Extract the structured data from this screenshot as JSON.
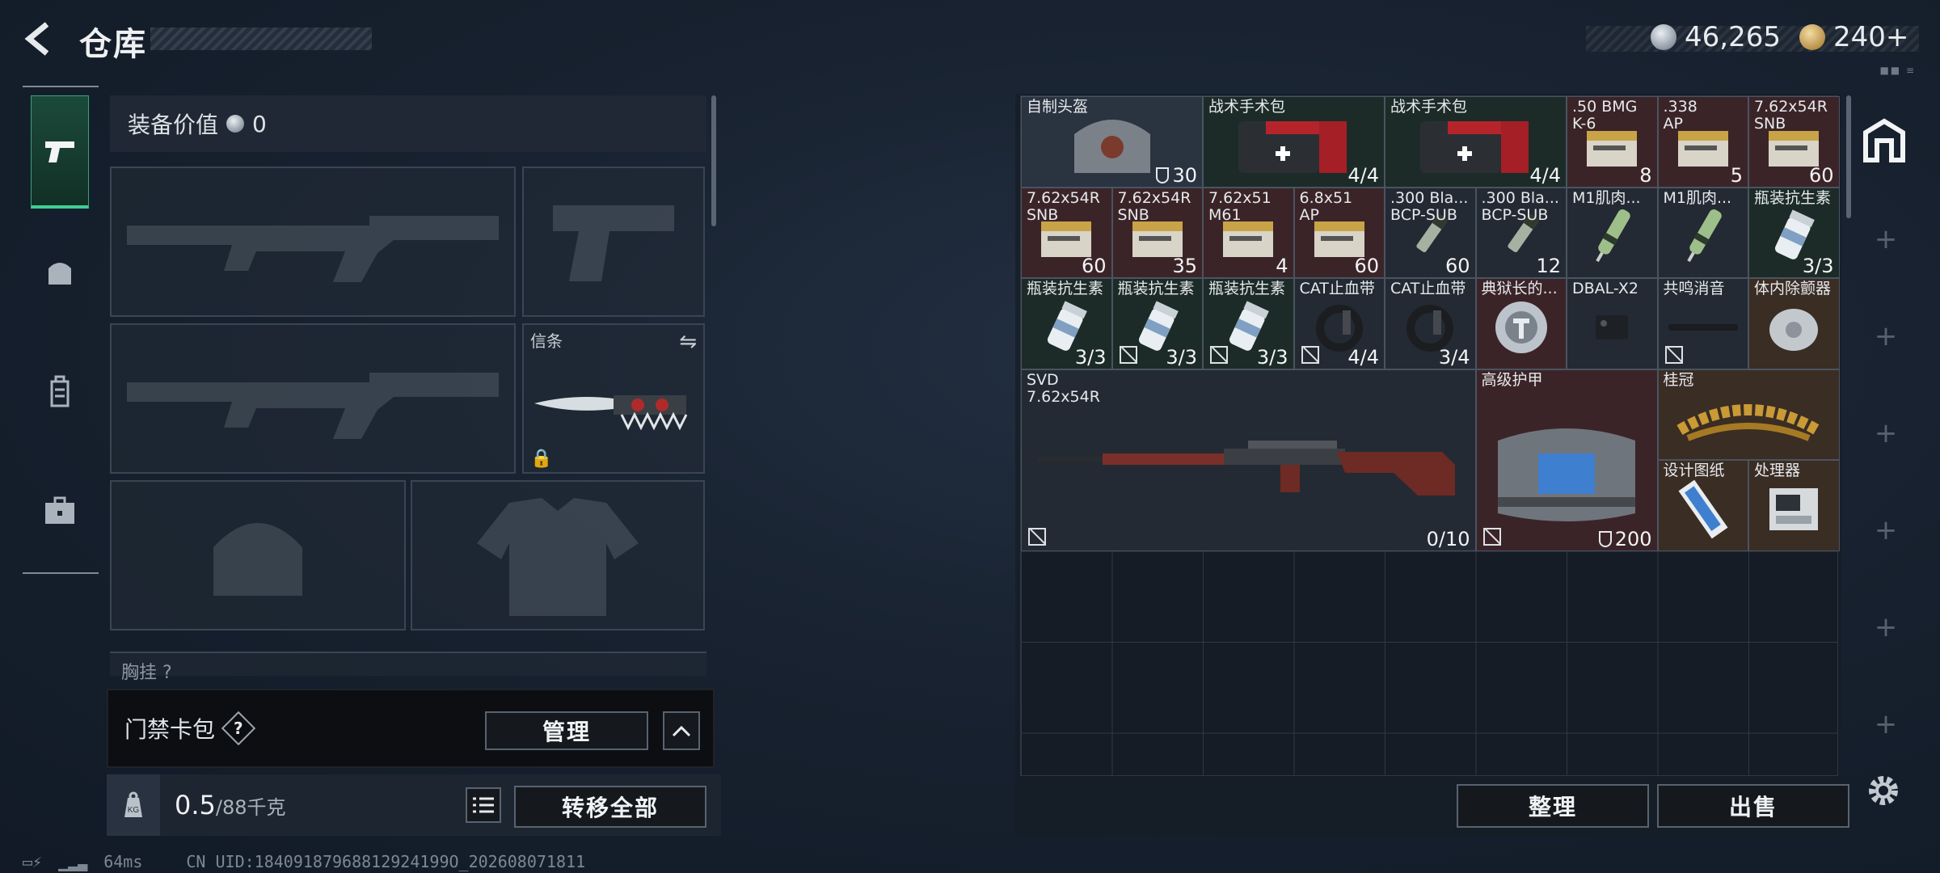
{
  "header": {
    "title": "仓库",
    "currency_silver": "46,265",
    "currency_gold": "240+",
    "deco": "■■ ≡"
  },
  "left_nav": {
    "items": [
      {
        "icon": "pistol-icon",
        "active": true
      },
      {
        "icon": "helmet-icon"
      },
      {
        "icon": "backpack-icon"
      },
      {
        "icon": "briefcase-icon"
      }
    ]
  },
  "equipment": {
    "value_label": "装备价值",
    "value": "0",
    "knife_slot_label": "信条",
    "chest_label": "胸挂 ?",
    "card_label": "门禁卡包",
    "manage_label": "管理",
    "weight": "0.5",
    "weight_max": "/88千克",
    "transfer_all_label": "转移全部"
  },
  "status": {
    "ping": "64ms",
    "uid": "CN UID:18409187968812924199O_202608071811"
  },
  "stash": {
    "items": [
      {
        "name": "自制头盔",
        "count": "30",
        "shield": true,
        "color": "grey",
        "icon": "helmet-item-icon"
      },
      {
        "name": "战术手术包",
        "count": "4/4",
        "color": "green",
        "icon": "first-aid-kit-icon"
      },
      {
        "name": "战术手术包",
        "count": "4/4",
        "color": "green",
        "icon": "first-aid-kit-icon"
      },
      {
        "name": ".50 BMG\nK-6",
        "count": "8",
        "color": "red",
        "icon": "ammo-box-icon"
      },
      {
        "name": ".338\nAP",
        "count": "5",
        "color": "red",
        "icon": "ammo-box-icon"
      },
      {
        "name": "7.62x54R\nSNB",
        "count": "60",
        "color": "red",
        "icon": "ammo-box-icon"
      },
      {
        "name": "7.62x54R\nSNB",
        "count": "60",
        "color": "red",
        "icon": "ammo-box-icon"
      },
      {
        "name": "7.62x54R\nSNB",
        "count": "35",
        "color": "red",
        "icon": "ammo-box-icon"
      },
      {
        "name": "7.62x51\nM61",
        "count": "4",
        "color": "red",
        "icon": "ammo-box-icon"
      },
      {
        "name": "6.8x51\nAP",
        "count": "60",
        "color": "red",
        "icon": "ammo-box-icon"
      },
      {
        "name": ".300 Bla...\nBCP-SUB",
        "count": "60",
        "color": "dark",
        "icon": "ammo-round-icon"
      },
      {
        "name": ".300 Bla...\nBCP-SUB",
        "count": "12",
        "color": "dark",
        "icon": "ammo-round-icon"
      },
      {
        "name": "M1肌肉...",
        "count": "",
        "color": "dark",
        "icon": "injector-icon"
      },
      {
        "name": "M1肌肉...",
        "count": "",
        "color": "dark",
        "icon": "injector-icon"
      },
      {
        "name": "瓶装抗生素",
        "count": "3/3",
        "color": "green",
        "icon": "pill-bottle-icon"
      },
      {
        "name": "瓶装抗生素",
        "count": "3/3",
        "color": "green",
        "icon": "pill-bottle-icon"
      },
      {
        "name": "瓶装抗生素",
        "count": "3/3",
        "color": "green",
        "badge": true,
        "icon": "pill-bottle-icon"
      },
      {
        "name": "瓶装抗生素",
        "count": "3/3",
        "color": "green",
        "badge": true,
        "icon": "pill-bottle-icon"
      },
      {
        "name": "CAT止血带",
        "count": "4/4",
        "color": "dark",
        "badge": true,
        "icon": "tourniquet-icon"
      },
      {
        "name": "CAT止血带",
        "count": "3/4",
        "color": "dark",
        "icon": "tourniquet-icon"
      },
      {
        "name": "典狱长的...",
        "count": "",
        "color": "red",
        "icon": "warden-badge-icon"
      },
      {
        "name": "DBAL-X2",
        "count": "",
        "color": "dark",
        "icon": "laser-module-icon"
      },
      {
        "name": "共鸣消音",
        "count": "",
        "color": "dark",
        "badge": true,
        "icon": "suppressor-icon"
      },
      {
        "name": "体内除颤器",
        "count": "",
        "color": "gold",
        "icon": "defibrillator-icon"
      },
      {
        "name": "SVD\n7.62x54R",
        "count": "0/10",
        "color": "dark",
        "badge": true,
        "icon": "svd-rifle-icon"
      },
      {
        "name": "高级护甲",
        "count": "200",
        "shield": true,
        "color": "red",
        "badge": true,
        "icon": "armor-vest-icon"
      },
      {
        "name": "桂冠",
        "count": "",
        "color": "gold",
        "icon": "laurel-crown-icon"
      },
      {
        "name": "设计图纸",
        "count": "",
        "color": "gold",
        "icon": "blueprint-icon"
      },
      {
        "name": "处理器",
        "count": "",
        "color": "gold",
        "icon": "processor-icon"
      }
    ],
    "sort_label": "整理",
    "sell_label": "出售"
  },
  "colors": {
    "accent": "#3fcf95",
    "grey": "#2a3340",
    "green": "#1c2b27",
    "red": "#3b2428",
    "dark": "#232a33",
    "gold": "#3a2d24"
  }
}
